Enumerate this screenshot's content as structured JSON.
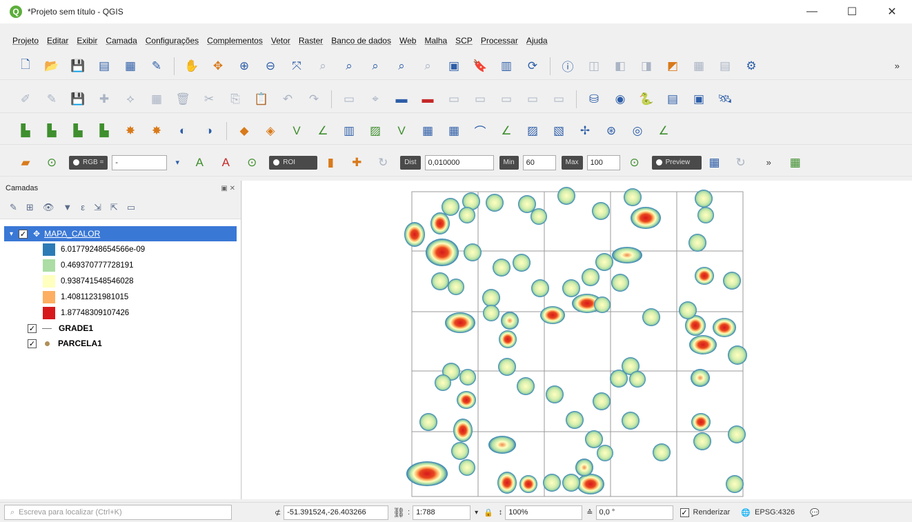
{
  "window": {
    "title": "*Projeto sem título - QGIS",
    "min": "—",
    "max": "☐",
    "close": "✕"
  },
  "menu": [
    "Projeto",
    "Editar",
    "Exibir",
    "Camada",
    "Configurações",
    "Complementos",
    "Vetor",
    "Raster",
    "Banco de dados",
    "Web",
    "Malha",
    "SCP",
    "Processar",
    "Ajuda"
  ],
  "scp": {
    "rgb_label": "RGB =",
    "rgb_value": "-",
    "roi_label": "ROI",
    "dist_label": "Dist",
    "dist_value": "0,010000",
    "min_label": "Min",
    "min_value": "60",
    "max_label": "Max",
    "max_value": "100",
    "preview_label": "Preview"
  },
  "layers_panel": {
    "title": "Camadas",
    "layers": [
      {
        "name": "MAPA_CALOR",
        "checked": true,
        "selected": true
      },
      {
        "name": "GRADE1",
        "checked": true
      },
      {
        "name": "PARCELA1",
        "checked": true
      }
    ],
    "legend": [
      {
        "label": "6.01779248654566e-09",
        "color": "#2c7bb6"
      },
      {
        "label": "0.469370777728191",
        "color": "#abdda4"
      },
      {
        "label": "0.938741548546028",
        "color": "#ffffbf"
      },
      {
        "label": "1.40811231981015",
        "color": "#fdae61"
      },
      {
        "label": "1.87748309107426",
        "color": "#d7191c"
      }
    ]
  },
  "status": {
    "search_placeholder": "Escreva para localizar (Ctrl+K)",
    "coord_label": "⊄",
    "coordinate": "-51.391524,-26.403266",
    "scale_label": ":",
    "scale": "1:788",
    "magnifier_label": "↕",
    "magnifier": "100%",
    "rotation_label": "≙",
    "rotation": "0,0 °",
    "render_label": "Renderizar",
    "render_checked": true,
    "crs": "EPSG:4326"
  }
}
